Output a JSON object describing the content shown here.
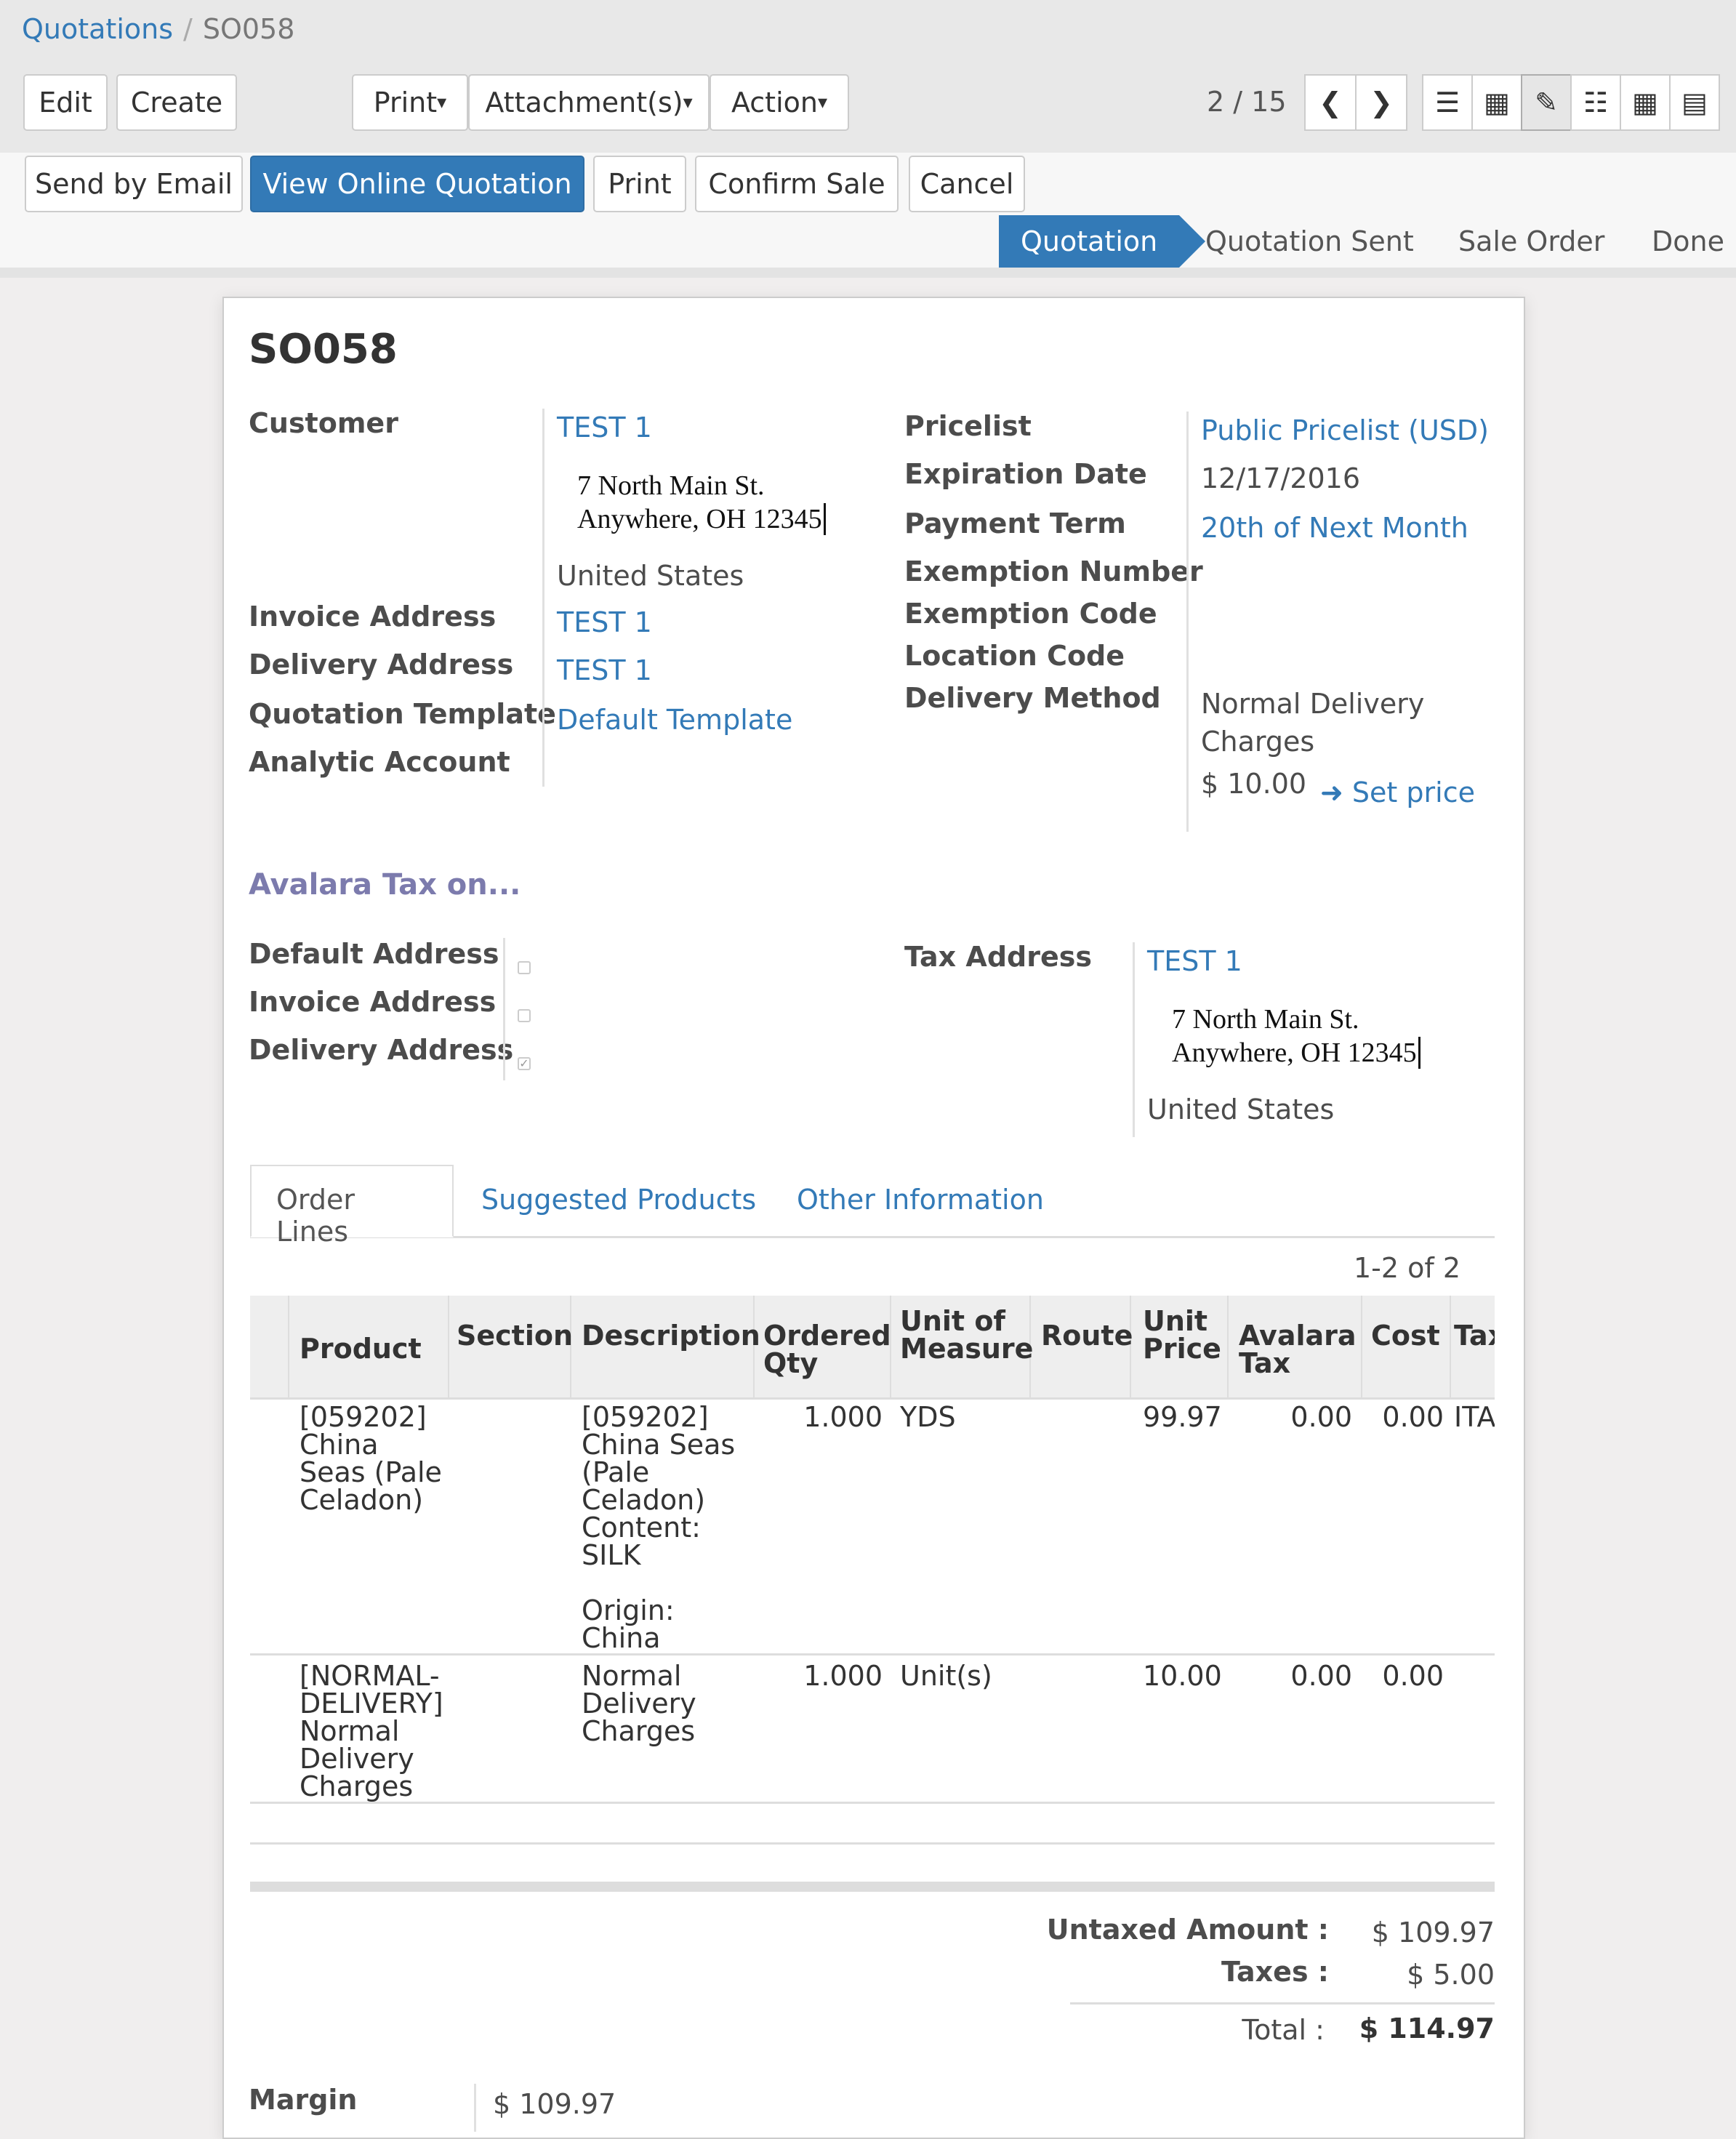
{
  "breadcrumb": {
    "parent": "Quotations",
    "separator": "/",
    "current": "SO058"
  },
  "toolbar": {
    "edit": "Edit",
    "create": "Create",
    "print": "Print",
    "attachments": "Attachment(s)",
    "action": "Action",
    "pager": "2 / 15"
  },
  "views": [
    "list-view-icon",
    "kanban-view-icon",
    "form-view-icon",
    "calendar-view-icon",
    "pivot-view-icon",
    "graph-view-icon"
  ],
  "actions": {
    "send_email": "Send by Email",
    "view_online": "View Online Quotation",
    "print": "Print",
    "confirm": "Confirm Sale",
    "cancel": "Cancel"
  },
  "stages": [
    "Quotation",
    "Quotation Sent",
    "Sale Order",
    "Done"
  ],
  "form": {
    "title": "SO058",
    "labels": {
      "customer": "Customer",
      "invoice_address": "Invoice Address",
      "delivery_address": "Delivery Address",
      "quotation_template": "Quotation Template",
      "analytic_account": "Analytic Account",
      "pricelist": "Pricelist",
      "expiration_date": "Expiration Date",
      "payment_term": "Payment Term",
      "exemption_number": "Exemption Number",
      "exemption_code": "Exemption Code",
      "location_code": "Location Code",
      "delivery_method": "Delivery Method"
    },
    "customer": {
      "name": "TEST 1",
      "street": "7 North Main St.",
      "city": "Anywhere, OH 12345",
      "country": "United States"
    },
    "invoice_address": "TEST 1",
    "delivery_address": "TEST 1",
    "quotation_template": "Default Template",
    "pricelist": "Public Pricelist (USD)",
    "expiration_date": "12/17/2016",
    "payment_term": "20th of Next Month",
    "delivery_method_line1": "Normal Delivery",
    "delivery_method_line2": "Charges",
    "delivery_price": "$ 10.00",
    "set_price": "Set price"
  },
  "avalara": {
    "section_title": "Avalara Tax on...",
    "default_address": "Default Address",
    "invoice_address": "Invoice Address",
    "delivery_address": "Delivery Address",
    "checks": {
      "default": false,
      "invoice": false,
      "delivery": true
    },
    "tax_address_label": "Tax Address",
    "tax_address": {
      "name": "TEST 1",
      "street": "7 North Main St.",
      "city": "Anywhere, OH 12345",
      "country": "United States"
    }
  },
  "tabs": [
    "Order Lines",
    "Suggested Products",
    "Other Information"
  ],
  "table": {
    "pager": "1-2 of 2",
    "headers": {
      "product": "Product",
      "section": "Section",
      "description": "Description",
      "ordered_qty_1": "Ordered",
      "ordered_qty_2": "Qty",
      "uom_1": "Unit of",
      "uom_2": "Measure",
      "route": "Route",
      "unit_price_1": "Unit",
      "unit_price_2": "Price",
      "avalara_tax_1": "Avalara",
      "avalara_tax_2": "Tax",
      "cost": "Cost",
      "tax": "Tax"
    },
    "rows": [
      {
        "product": [
          "[059202]",
          "China",
          "Seas (Pale",
          "Celadon)"
        ],
        "description": [
          "[059202]",
          "China Seas",
          "(Pale",
          "Celadon)",
          "Content:",
          "SILK",
          "",
          "Origin:",
          "China"
        ],
        "qty": "1.000",
        "uom": "YDS",
        "price": "99.97",
        "avalara": "0.00",
        "cost": "0.00",
        "tax": "ITA"
      },
      {
        "product": [
          "[NORMAL-",
          "DELIVERY]",
          "Normal",
          "Delivery",
          "Charges"
        ],
        "description": [
          "Normal",
          "Delivery",
          "Charges"
        ],
        "qty": "1.000",
        "uom": "Unit(s)",
        "price": "10.00",
        "avalara": "0.00",
        "cost": "0.00",
        "tax": ""
      }
    ]
  },
  "totals": {
    "untaxed_label": "Untaxed Amount :",
    "untaxed": "$ 109.97",
    "taxes_label": "Taxes :",
    "taxes": "$ 5.00",
    "total_label": "Total :",
    "total": "$ 114.97"
  },
  "margin": {
    "label": "Margin",
    "value": "$ 109.97"
  }
}
